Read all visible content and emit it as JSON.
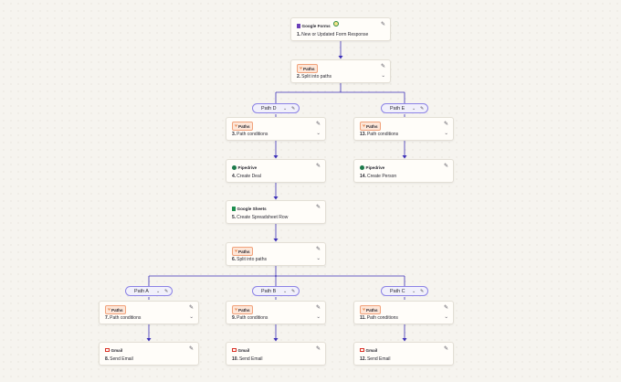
{
  "nodes": {
    "n1": {
      "app": "Google Forms",
      "num": "1.",
      "title": "New or Updated Form Response"
    },
    "n2": {
      "app": "Paths",
      "num": "2.",
      "title": "Split into paths"
    },
    "n3": {
      "app": "Paths",
      "num": "3.",
      "title": "Path conditions"
    },
    "n13": {
      "app": "Paths",
      "num": "13.",
      "title": "Path conditions"
    },
    "n4": {
      "app": "Pipedrive",
      "num": "4.",
      "title": "Create Deal"
    },
    "n14": {
      "app": "Pipedrive",
      "num": "14.",
      "title": "Create Person"
    },
    "n5": {
      "app": "Google Sheets",
      "num": "5.",
      "title": "Create Spreadsheet Row"
    },
    "n6": {
      "app": "Paths",
      "num": "6.",
      "title": "Split into paths"
    },
    "n7": {
      "app": "Paths",
      "num": "7.",
      "title": "Path conditions"
    },
    "n9": {
      "app": "Paths",
      "num": "9.",
      "title": "Path conditions"
    },
    "n11": {
      "app": "Paths",
      "num": "11.",
      "title": "Path conditions"
    },
    "n8": {
      "app": "Gmail",
      "num": "8.",
      "title": "Send Email"
    },
    "n10": {
      "app": "Gmail",
      "num": "10.",
      "title": "Send Email"
    },
    "n12": {
      "app": "Gmail",
      "num": "12.",
      "title": "Send Email"
    }
  },
  "paths": {
    "pD": "Path D",
    "pE": "Path E",
    "pA": "Path A",
    "pB": "Path B",
    "pC": "Path C"
  },
  "icons": {
    "edit": "pencil-icon",
    "chevron": "chevron-down-icon",
    "badge": "status-badge"
  },
  "colors": {
    "connector": "#3b2fb8",
    "path_pill_border": "#8c83e6",
    "paths_badge_bg": "#fde6d8",
    "canvas_bg": "#f6f4ef"
  }
}
